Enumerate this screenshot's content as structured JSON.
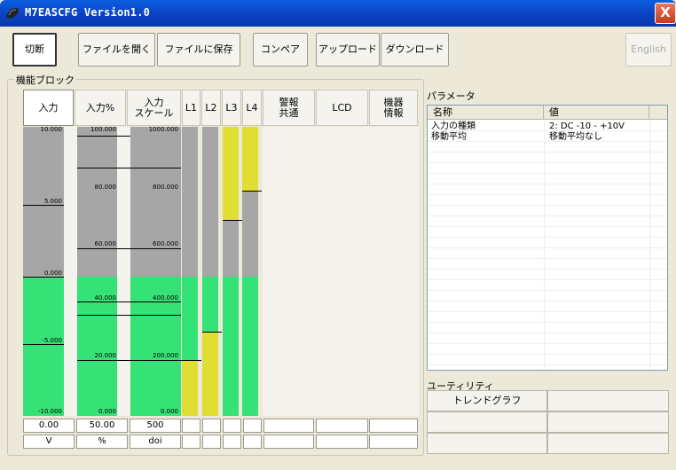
{
  "window": {
    "title": "M7EASCFG Version1.0",
    "close_label": "X"
  },
  "toolbar": {
    "disconnect": "切断",
    "open_file": "ファイルを開く",
    "save_file": "ファイルに保存",
    "compare": "コンペア",
    "upload": "アップロード",
    "download": "ダウンロード",
    "english": "English"
  },
  "function_block": {
    "legend": "機能ブロック",
    "tabs": [
      {
        "label": "入力"
      },
      {
        "label": "入力%"
      },
      {
        "label": "入力\nスケール"
      },
      {
        "label": "L1"
      },
      {
        "label": "L2"
      },
      {
        "label": "L3"
      },
      {
        "label": "L4"
      },
      {
        "label": "警報\n共通"
      },
      {
        "label": "LCD"
      },
      {
        "label": "機器\n情報"
      }
    ]
  },
  "meters": {
    "input_ticks": [
      "10.000",
      "5.000",
      "0.000",
      "-5.000",
      "-10.000"
    ],
    "percent_ticks": [
      "100.000",
      "80.000",
      "60.000",
      "40.000",
      "20.000",
      "0.000"
    ],
    "scale_ticks": [
      "1000.000",
      "800.000",
      "600.000",
      "400.000",
      "200.000",
      "0.000"
    ],
    "current_level_fraction": 0.5,
    "alarm_levels": {
      "L1": 0.2,
      "L2": 0.3,
      "L3": 0.68,
      "L4": 0.78
    },
    "colors": {
      "normal": "#a6a6a6",
      "active": "#35e275",
      "alarm": "#e0dd33"
    }
  },
  "values": {
    "input": "0.00",
    "percent": "50.00",
    "scale": "500",
    "unit_input": "V",
    "unit_percent": "%",
    "unit_scale": "doi"
  },
  "parameters": {
    "legend": "パラメータ",
    "col_name": "名称",
    "col_value": "値",
    "rows": [
      {
        "name": "入力の種類",
        "value": "2: DC -10 - +10V"
      },
      {
        "name": "移動平均",
        "value": "移動平均なし"
      }
    ]
  },
  "utility": {
    "legend": "ユーティリティ",
    "trend_graph": "トレンドグラフ"
  }
}
